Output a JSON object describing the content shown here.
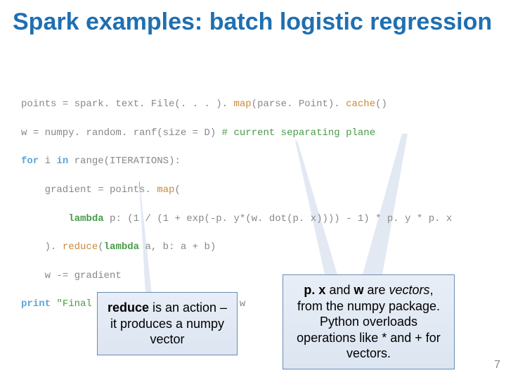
{
  "title": "Spark examples: batch logistic regression",
  "code": {
    "l1a": "points = spark. text. File(. . . ). ",
    "l1b": "map",
    "l1c": "(parse. Point). ",
    "l1d": "cache",
    "l1e": "()",
    "l2a": "w = numpy. random. ranf(size = D) ",
    "l2b": "# current separating plane",
    "l3a": "for",
    "l3b": " i ",
    "l3c": "in",
    "l3d": " range(ITERATIONS):",
    "l4a": "    gradient = points. ",
    "l4b": "map",
    "l4c": "(",
    "l5a": "        ",
    "l5b": "lambda",
    "l5c": " p: (1 / (1 + exp(-p. y*(w. dot(p. x)))) - 1) * p. y * p. x",
    "l6a": "    ). ",
    "l6b": "reduce",
    "l6c": "(",
    "l6d": "lambda",
    "l6e": " a, b: a + b)",
    "l7": "    w -= gradient",
    "l8a": "print",
    "l8b": " ",
    "l8c": "\"Final separating plane: %s\"",
    "l8d": " % w"
  },
  "callouts": {
    "left_bold": "reduce",
    "left_rest": " is an action – it produces a numpy vector",
    "right_b1": "p. x",
    "right_mid1": " and ",
    "right_b2": "w",
    "right_mid2": " are ",
    "right_ital": "vectors",
    "right_rest": ", from the numpy package.  Python overloads operations like * and + for vectors."
  },
  "page_number": "7"
}
